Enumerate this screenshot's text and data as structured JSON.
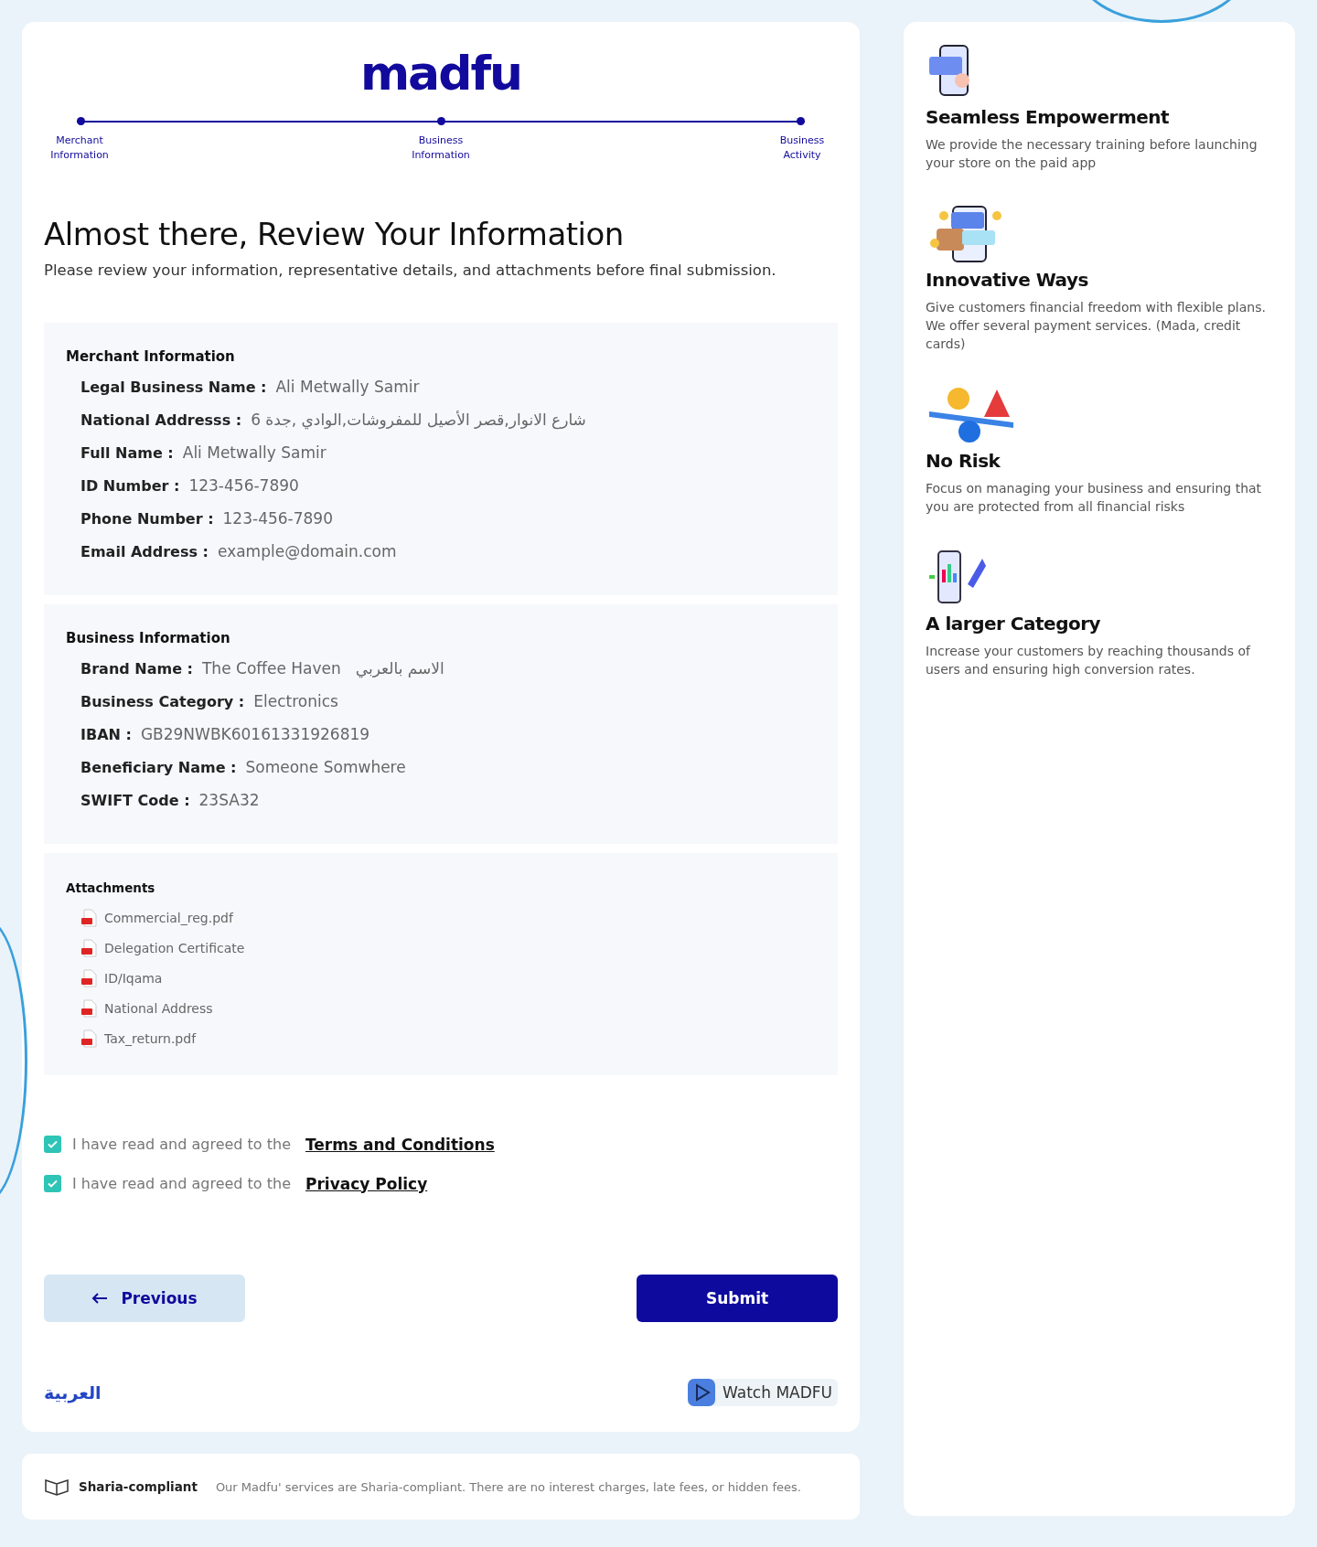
{
  "logo": "madfu",
  "steps": [
    {
      "label": "Merchant Information"
    },
    {
      "label": "Business Information"
    },
    {
      "label": "Business Activity"
    }
  ],
  "heading": "Almost there, Review Your Information",
  "subheading": "Please review your information, representative details, and attachments before final submission.",
  "sections": [
    {
      "title": "Merchant Information",
      "fields": [
        {
          "label": "Legal Business Name :",
          "value": "Ali Metwally Samir"
        },
        {
          "label": "National Addresss :",
          "value": "6 شارع الانوار,قصر الأصيل للمفروشات,الوادي ,جدة"
        },
        {
          "label": "Full Name :",
          "value": "Ali Metwally Samir"
        },
        {
          "label": "ID Number :",
          "value": "123-456-7890"
        },
        {
          "label": "Phone Number :",
          "value": "123-456-7890"
        },
        {
          "label": "Email Address :",
          "value": "example@domain.com"
        }
      ]
    },
    {
      "title": "Business Information",
      "fields": [
        {
          "label": "Brand Name :",
          "value": "The Coffee Haven",
          "extra": "الاسم بالعربي"
        },
        {
          "label": "Business Category :",
          "value": "Electronics"
        },
        {
          "label": "IBAN :",
          "value": "GB29NWBK60161331926819"
        },
        {
          "label": "Beneficiary Name :",
          "value": "Someone Somwhere"
        },
        {
          "label": "SWIFT Code :",
          "value": "23SA32"
        }
      ]
    }
  ],
  "attachments": {
    "title": "Attachments",
    "files": [
      "Commercial_reg.pdf",
      "Delegation Certificate",
      "ID/Iqama",
      "National Address",
      "Tax_return.pdf"
    ]
  },
  "agreements": [
    {
      "text": "I have read and agreed to the",
      "link": "Terms and Conditions",
      "checked": true
    },
    {
      "text": "I have read and agreed to the",
      "link": "Privacy Policy",
      "checked": true
    }
  ],
  "buttons": {
    "previous": "Previous",
    "submit": "Submit"
  },
  "language_link": "العربية",
  "watch_button": "Watch MADFU",
  "footer": {
    "badge": "Sharia-compliant",
    "text": "Our Madfu' services are Sharia-compliant. There are no interest charges, late fees, or hidden fees."
  },
  "features": [
    {
      "title": "Seamless Empowerment",
      "text": "We provide the necessary training before launching your store on the paid app"
    },
    {
      "title": "Innovative Ways",
      "text": "Give customers financial freedom with flexible plans. We offer several payment services. (Mada, credit cards)"
    },
    {
      "title": "No Risk",
      "text": "Focus on managing your business and ensuring that you are protected from all financial risks"
    },
    {
      "title": "A larger Category",
      "text": "Increase your customers by reaching thousands of users and ensuring high conversion rates."
    }
  ]
}
